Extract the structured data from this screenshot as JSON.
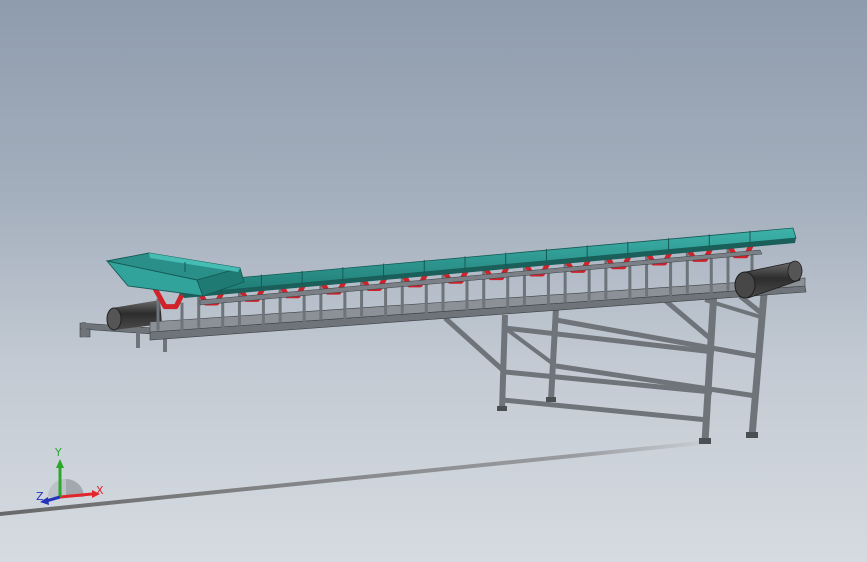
{
  "viewport": {
    "background_top": "#8f9cad",
    "background_bottom": "#d6dbe1"
  },
  "model": {
    "name": "belt-conveyor",
    "colors": {
      "frame": "#6e7479",
      "frame_dark": "#3c4145",
      "skirt": "#2f9a92",
      "skirt_dark": "#1d6e69",
      "idler": "#d0222a",
      "drum": "#3a3a3a"
    }
  },
  "triad": {
    "x_label": "X",
    "y_label": "Y",
    "z_label": "Z",
    "x_color": "#e0262b",
    "y_color": "#2ba82b",
    "z_color": "#2533b8"
  }
}
